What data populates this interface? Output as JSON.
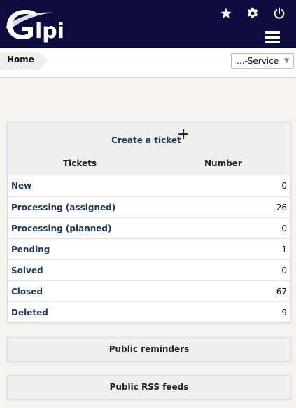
{
  "header": {
    "logo_text": "Glpi",
    "icons": [
      "star-icon",
      "gear-icon",
      "power-icon",
      "menu-icon"
    ],
    "background": "#0e0c3f"
  },
  "breadcrumb": {
    "home": "Home"
  },
  "entity_select": {
    "value": "...-Service"
  },
  "tickets_panel": {
    "create_label": "Create a ticket",
    "plus": "+",
    "col_tickets": "Tickets",
    "col_number": "Number",
    "rows": [
      {
        "label": "New",
        "count": "0"
      },
      {
        "label": "Processing (assigned)",
        "count": "26"
      },
      {
        "label": "Processing (planned)",
        "count": "0"
      },
      {
        "label": "Pending",
        "count": "1"
      },
      {
        "label": "Solved",
        "count": "0"
      },
      {
        "label": "Closed",
        "count": "67"
      },
      {
        "label": "Deleted",
        "count": "9"
      }
    ]
  },
  "public_reminders": {
    "label": "Public reminders"
  },
  "public_rss": {
    "label": "Public RSS feeds"
  }
}
